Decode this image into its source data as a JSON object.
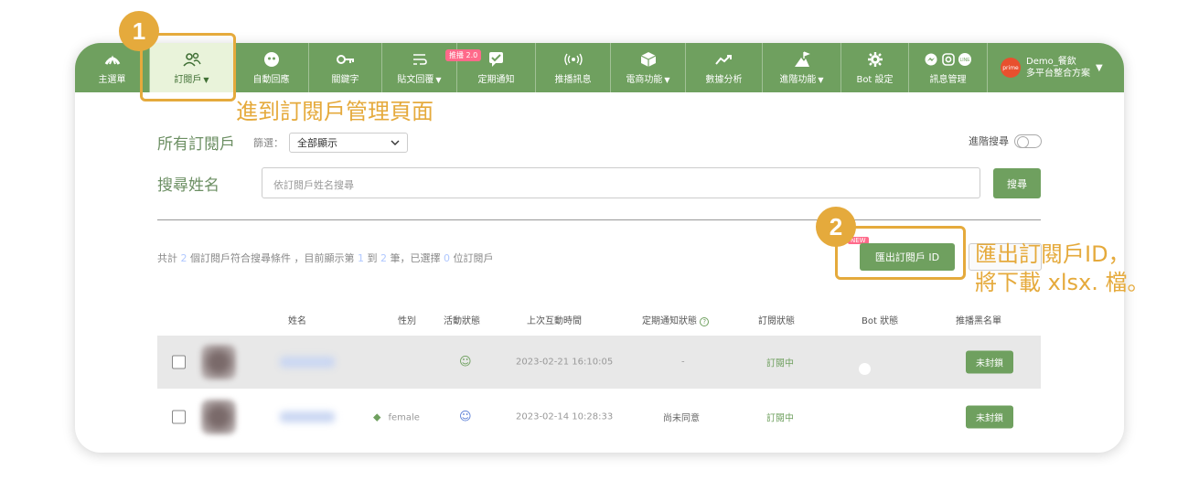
{
  "nav": {
    "items": [
      {
        "label": "主選單",
        "icon": "spark-icon",
        "caret": false
      },
      {
        "label": "訂閱戶",
        "icon": "users-icon",
        "caret": true
      },
      {
        "label": "自動回應",
        "icon": "robot-icon",
        "caret": false
      },
      {
        "label": "關鍵字",
        "icon": "key-icon",
        "caret": false
      },
      {
        "label": "貼文回覆",
        "icon": "wrap-icon",
        "caret": true
      },
      {
        "label": "定期通知",
        "icon": "notify-icon",
        "caret": false
      },
      {
        "label": "推播訊息",
        "icon": "broadcast-icon",
        "caret": false
      },
      {
        "label": "電商功能",
        "icon": "box-icon",
        "caret": true
      },
      {
        "label": "數據分析",
        "icon": "chart-icon",
        "caret": false
      },
      {
        "label": "進階功能",
        "icon": "mountain-icon",
        "caret": true
      },
      {
        "label": "Bot 設定",
        "icon": "gear-icon",
        "caret": false
      },
      {
        "label": "訊息管理",
        "icon": "messenger-icon",
        "caret": false
      }
    ],
    "new_badge": "推播 2.0",
    "account": {
      "line1": "Demo_餐飲",
      "line2": "多平台整合方案",
      "logo_text": "prime"
    },
    "caret_glyph": "▼"
  },
  "header": {
    "title": "所有訂閱戶",
    "filter_label": "篩選：",
    "filter_value": "全部顯示",
    "advanced_search": "進階搜尋"
  },
  "search": {
    "label": "搜尋姓名",
    "placeholder": "依訂閱戶姓名搜尋",
    "button": "搜尋"
  },
  "summary": {
    "p1": "共計",
    "total": "2",
    "p2": "個訂閱戶符合搜尋條件 ，目前顯示第",
    "from": "1",
    "p3": "到",
    "to": "2",
    "p4": "筆，已選擇",
    "selected": "0",
    "p5": "位訂閱戶"
  },
  "export": {
    "button": "匯出訂閱戶 ID",
    "new_tag": "NEW"
  },
  "table": {
    "headers": {
      "name": "姓名",
      "gender": "性別",
      "activity": "活動狀態",
      "last_interaction": "上次互動時間",
      "notify_status": "定期通知狀態",
      "subscription": "訂閱狀態",
      "bot_status": "Bot 狀態",
      "blacklist": "推播黑名單"
    },
    "help_glyph": "?",
    "rows": [
      {
        "gender": "",
        "activity_icon": "☺",
        "time": "2023-02-21 16:10:05",
        "notify": "-",
        "subscription": "訂閱中",
        "blacklist": "未封鎖"
      },
      {
        "gender": "female",
        "activity_icon": "☺",
        "time": "2023-02-14 10:28:33",
        "notify": "尚未同意",
        "subscription": "訂閱中",
        "blacklist": "未封鎖"
      }
    ]
  },
  "annotations": {
    "step1": "1",
    "step1_note": "進到訂閱戶管理頁面",
    "step2": "2",
    "step2_line1": "匯出訂閱戶ID，",
    "step2_line2": "將下載 xlsx. 檔。"
  },
  "colors": {
    "brand_green": "#6fa05f",
    "callout": "#e5aa3c",
    "new_pink": "#ff6a8a"
  }
}
